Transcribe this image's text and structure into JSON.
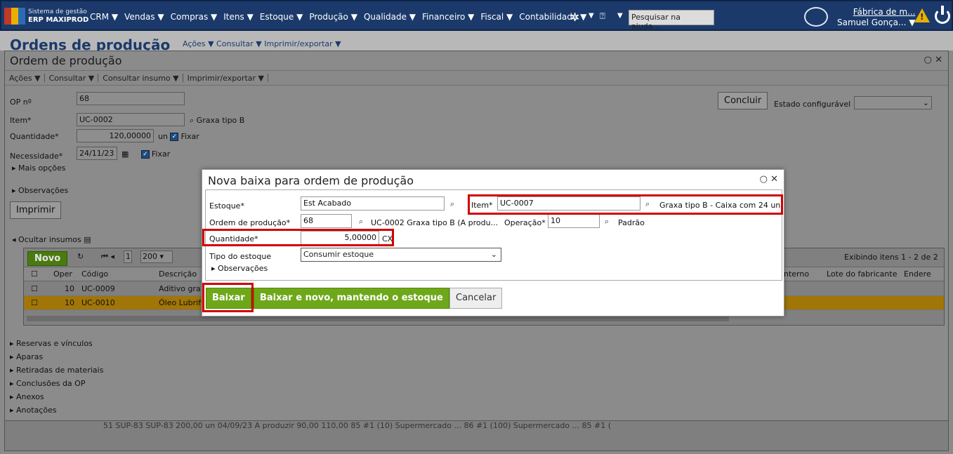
{
  "topbar": {
    "system_line": "Sistema de gestão",
    "erp_name": "ERP MAXIPROD",
    "menu": [
      "CRM ▼",
      "Vendas ▼",
      "Compras ▼",
      "Itens ▼",
      "Estoque ▼",
      "Produção ▼",
      "Qualidade ▼",
      "Financeiro ▼",
      "Fiscal ▼",
      "Contabilidade ▼"
    ],
    "help_placeholder": "Pesquisar na ajuda...",
    "company": "Fábrica de m...",
    "user": "Samuel Gonça... ▼"
  },
  "page": {
    "title": "Ordens de produção",
    "menu": "Ações ▼  Consultar ▼  Imprimir/exportar ▼"
  },
  "panel": {
    "title": "Ordem de produção",
    "toolbar": [
      "Ações ▼",
      "Consultar ▼",
      "Consultar insumo ▼",
      "Imprimir/exportar ▼"
    ],
    "op_label": "OP nº",
    "op_value": "68",
    "item_label": "Item*",
    "item_value": "UC-0002",
    "item_desc": "Graxa tipo B",
    "qty_label": "Quantidade*",
    "qty_value": "120,00000",
    "qty_unit": "un",
    "fixar": "Fixar",
    "need_label": "Necessidade*",
    "need_value": "24/11/23",
    "more": "Mais opções",
    "obs": "Observações",
    "print": "Imprimir",
    "conclude": "Concluir",
    "state_label": "Estado configurável",
    "hide_inputs": "Ocultar insumos"
  },
  "grid": {
    "new": "Novo",
    "page": "1",
    "per_page": "200",
    "showing": "Exibindo itens 1 - 2 de 2",
    "headers": [
      "Oper",
      "Código",
      "Descrição",
      "nterno",
      "Lote do fabricante",
      "Endere"
    ],
    "rows": [
      {
        "oper": "10",
        "code": "UC-0009",
        "desc": "Aditivo gra"
      },
      {
        "oper": "10",
        "code": "UC-0010",
        "desc": "Óleo Lubrifi"
      }
    ]
  },
  "sections": [
    "Reservas e vínculos",
    "Aparas",
    "Retiradas de materiais",
    "Conclusões da OP",
    "Anexos",
    "Anotações"
  ],
  "bg_row": "51  SUP-83       SUP-83       200,00     un  04/09/23     A produzir   90,00   110,00   85 #1 (10) Supermercado ...   86 #1 (100) Supermercado ...   85 #1 (",
  "modal": {
    "title": "Nova baixa para ordem de produção",
    "stock_label": "Estoque*",
    "stock_value": "Est Acabado",
    "item_label": "Item*",
    "item_value": "UC-0007",
    "item_desc": "Graxa tipo B - Caixa com 24 un",
    "op_label": "Ordem de produção*",
    "op_value": "68",
    "op_desc": "UC-0002 Graxa tipo B (A produ...",
    "oper_label": "Operação*",
    "oper_value": "10",
    "oper_desc": "Padrão",
    "qty_label": "Quantidade*",
    "qty_value": "5,00000",
    "qty_unit": "CX",
    "stock_type_label": "Tipo do estoque",
    "stock_type_value": "Consumir estoque",
    "obs": "Observações",
    "btn_baixar": "Baixar",
    "btn_baixar_novo": "Baixar e novo, mantendo o estoque",
    "btn_cancel": "Cancelar"
  },
  "colors": {
    "accent_green": "#6ea81a",
    "highlight_red": "#d00000",
    "navy": "#1b3a6b"
  }
}
